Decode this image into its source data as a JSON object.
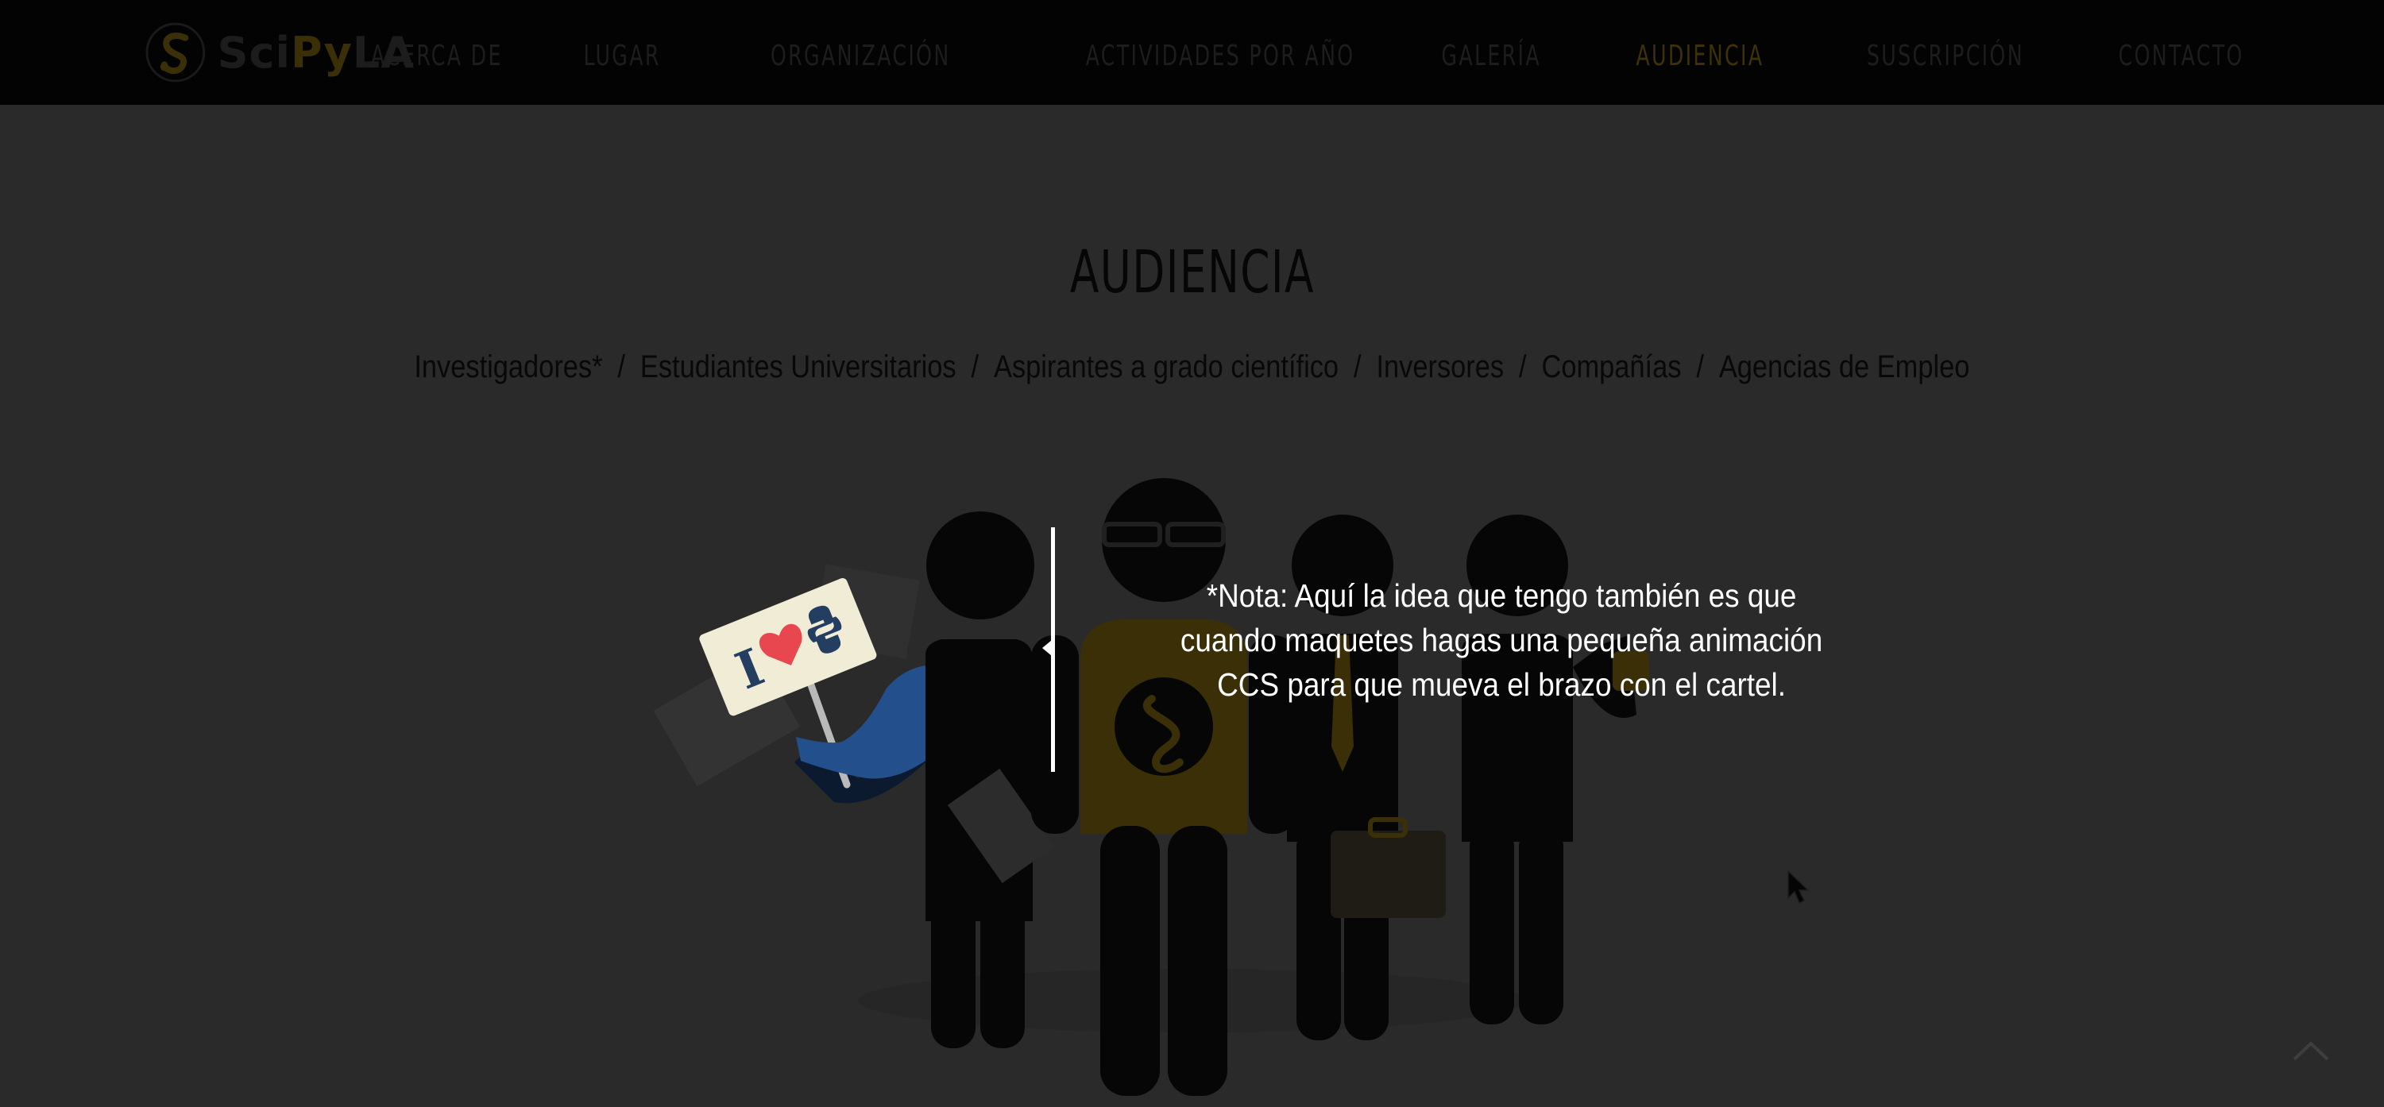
{
  "brand": {
    "logo_parts": {
      "sci": "Sci",
      "py": "Py",
      "la": "LA"
    },
    "colors": {
      "accent": "#f2c318",
      "nav_bg": "#030303",
      "overlay_bg": "#2a2a2a"
    }
  },
  "nav": {
    "items": [
      {
        "label": "ACERCA DE",
        "active": false
      },
      {
        "label": "LUGAR",
        "active": false
      },
      {
        "label": "ORGANIZACIÓN",
        "active": false
      },
      {
        "label": "ACTIVIDADES  POR AÑO",
        "active": false
      },
      {
        "label": "GALERÍA",
        "active": false
      },
      {
        "label": "AUDIENCIA",
        "active": true
      },
      {
        "label": "SUSCRIPCIÓN",
        "active": false
      },
      {
        "label": "CONTACTO",
        "active": false
      }
    ]
  },
  "main": {
    "title": "AUDIENCIA",
    "audience": [
      "Investigadores*",
      "Estudiantes Universitarios",
      "Aspirantes a grado científico",
      "Inversores",
      "Compañías",
      "Agencias de Empleo"
    ],
    "separator": "/"
  },
  "sign": {
    "letter": "I"
  },
  "note": {
    "lines": [
      "*Nota: Aquí la idea que tengo también es que",
      "cuando maquetes hagas una pequeña animación",
      "CCS para que mueva el brazo con el cartel."
    ]
  },
  "icons": {
    "logo": "scipyla-logo-icon",
    "cursor": "mouse-pointer-icon",
    "back_to_top": "chevron-up-icon",
    "heart": "heart-icon",
    "python": "python-logo-icon"
  }
}
